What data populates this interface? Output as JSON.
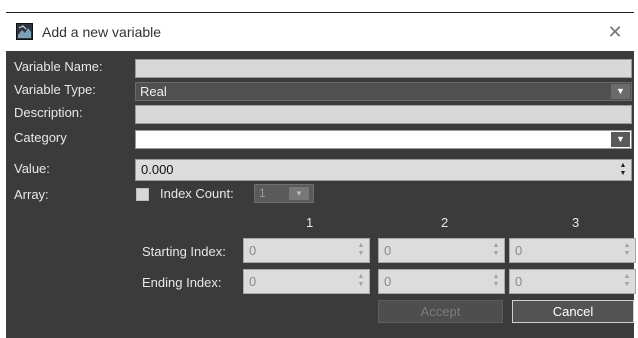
{
  "dialog": {
    "title": "Add a new variable",
    "close_glyph": "✕",
    "icon": "app-icon"
  },
  "form": {
    "variable_name": {
      "label": "Variable Name:",
      "value": ""
    },
    "variable_type": {
      "label": "Variable Type:",
      "value": "Real"
    },
    "description": {
      "label": "Description:",
      "value": ""
    },
    "category": {
      "label": "Category",
      "value": ""
    },
    "value": {
      "label": "Value:",
      "value": "0.000"
    },
    "array": {
      "label": "Array:",
      "index_count_label": "Index Count:",
      "index_count_value": "1",
      "checked": false,
      "columns": [
        "1",
        "2",
        "3"
      ],
      "starting_index": {
        "label": "Starting Index:",
        "values": [
          "0",
          "0",
          "0"
        ]
      },
      "ending_index": {
        "label": "Ending Index:",
        "values": [
          "0",
          "0",
          "0"
        ]
      }
    }
  },
  "buttons": {
    "accept": "Accept",
    "cancel": "Cancel"
  },
  "glyphs": {
    "dropdown": "▼",
    "spin": "▲\n▼"
  },
  "colors": {
    "panel_bg": "#3b3b3b",
    "field_bg": "#d8d8d8",
    "select_bg": "#505050"
  }
}
